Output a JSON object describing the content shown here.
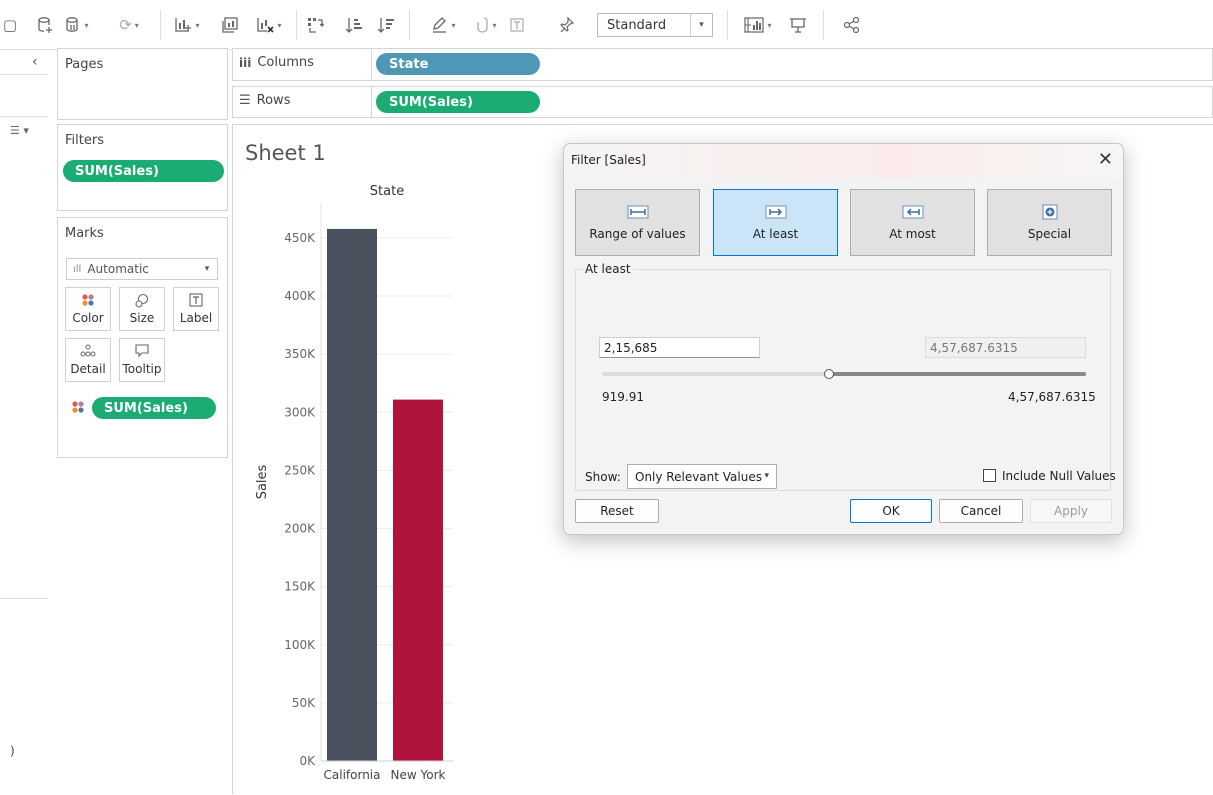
{
  "toolbar": {
    "mark_size_select": "Standard"
  },
  "shelves": {
    "columns_label": "Columns",
    "rows_label": "Rows",
    "columns_pill": "State",
    "rows_pill": "SUM(Sales)"
  },
  "cards": {
    "pages_title": "Pages",
    "filters_title": "Filters",
    "filters_pill": "SUM(Sales)",
    "marks_title": "Marks",
    "marks_type": "Automatic",
    "mark_buttons": [
      "Color",
      "Size",
      "Label",
      "Detail",
      "Tooltip"
    ],
    "marks_pill": "SUM(Sales)"
  },
  "sheet": {
    "title": "Sheet 1"
  },
  "chart_data": {
    "type": "bar",
    "xlabel": "State",
    "ylabel": "Sales",
    "categories": [
      "California",
      "New York"
    ],
    "values": [
      457688,
      310876
    ],
    "ylim": [
      0,
      480000
    ],
    "yticks": [
      0,
      50000,
      100000,
      150000,
      200000,
      250000,
      300000,
      350000,
      400000,
      450000
    ],
    "ytick_labels": [
      "0K",
      "50K",
      "100K",
      "150K",
      "200K",
      "250K",
      "300K",
      "350K",
      "400K",
      "450K"
    ],
    "colors": [
      "#4a515c",
      "#b0133b"
    ],
    "grid": true
  },
  "dialog": {
    "title": "Filter [Sales]",
    "tabs": [
      "Range of values",
      "At least",
      "At most",
      "Special"
    ],
    "active_tab": "At least",
    "group_label": "At least",
    "min_value": "2,15,685",
    "max_value": "4,57,687.6315",
    "range_min": "919.91",
    "range_max": "4,57,687.6315",
    "slider_position": 0.47,
    "show_label": "Show:",
    "show_value": "Only Relevant Values",
    "include_null": "Include Null Values",
    "buttons": {
      "reset": "Reset",
      "ok": "OK",
      "cancel": "Cancel",
      "apply": "Apply"
    }
  },
  "colors": {
    "green_pill": "#1aac73",
    "blue_pill": "#4e98b5",
    "accent": "#0078d7"
  }
}
